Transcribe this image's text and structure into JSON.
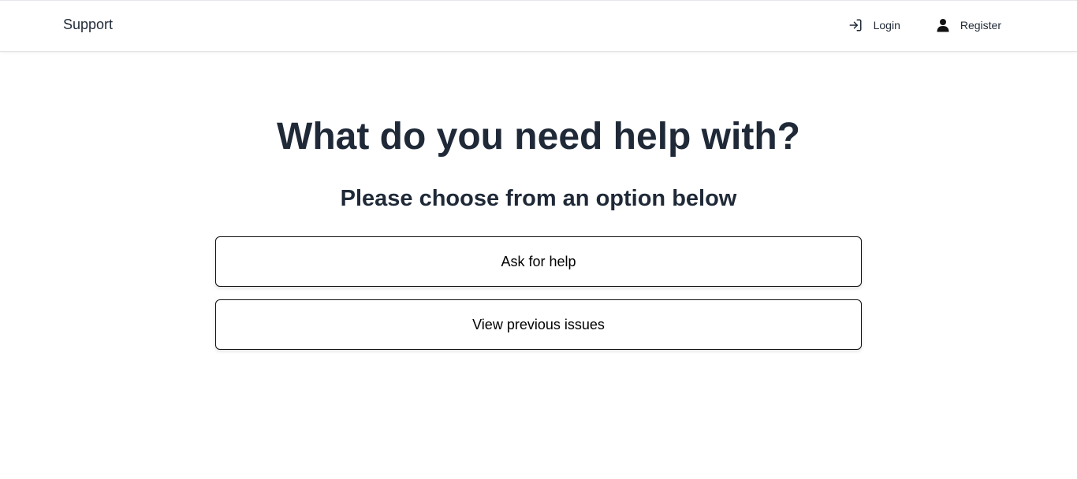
{
  "header": {
    "brand": "Support",
    "nav": {
      "login_label": "Login",
      "login_icon": "sign-in-icon",
      "register_label": "Register",
      "register_icon": "user-icon"
    }
  },
  "main": {
    "title": "What do you need help with?",
    "subtitle": "Please choose from an option below",
    "options": [
      {
        "label": "Ask for help"
      },
      {
        "label": "View previous issues"
      }
    ]
  },
  "colors": {
    "text": "#1f2937",
    "button_border": "#111111",
    "background": "#ffffff"
  }
}
